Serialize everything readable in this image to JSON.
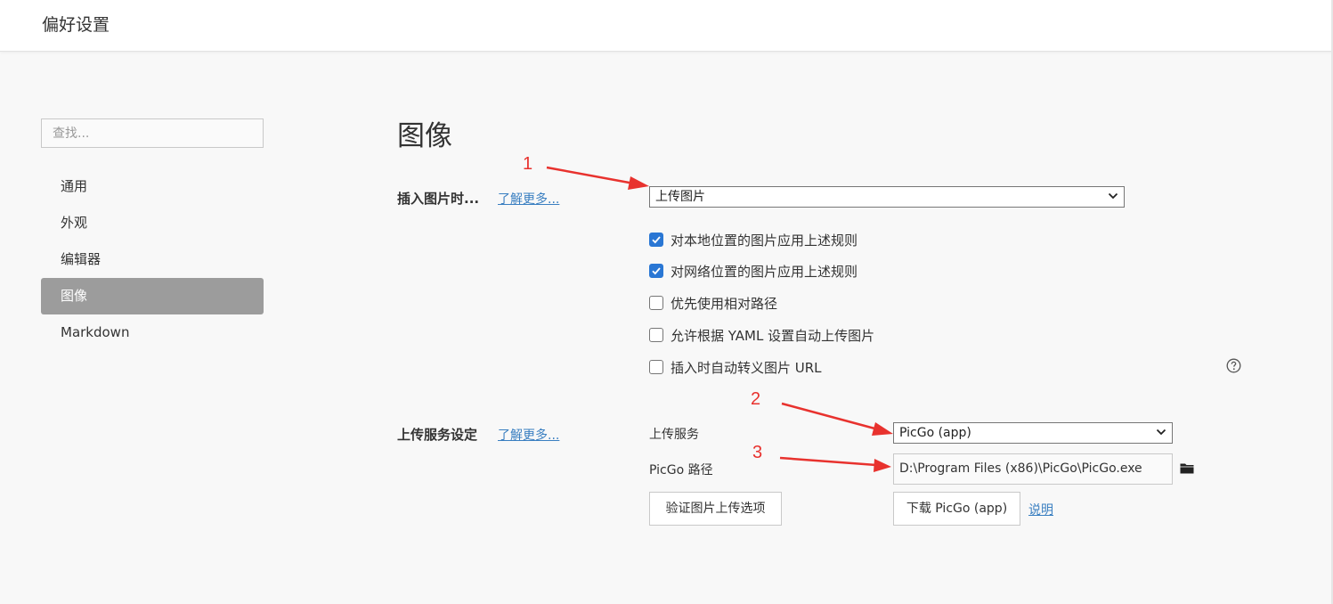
{
  "window": {
    "title": "偏好设置"
  },
  "sidebar": {
    "search_placeholder": "查找...",
    "items": [
      {
        "label": "通用",
        "active": false
      },
      {
        "label": "外观",
        "active": false
      },
      {
        "label": "编辑器",
        "active": false
      },
      {
        "label": "图像",
        "active": true
      },
      {
        "label": "Markdown",
        "active": false
      }
    ]
  },
  "main": {
    "title": "图像",
    "insert_section": {
      "label": "插入图片时...",
      "learn_more": "了解更多...",
      "action_select": "上传图片",
      "options": [
        {
          "label": "对本地位置的图片应用上述规则",
          "checked": true
        },
        {
          "label": "对网络位置的图片应用上述规则",
          "checked": true
        },
        {
          "label": "优先使用相对路径",
          "checked": false
        },
        {
          "label": "允许根据 YAML 设置自动上传图片",
          "checked": false
        },
        {
          "label": "插入时自动转义图片 URL",
          "checked": false
        }
      ],
      "help_icon": "question-circle-icon"
    },
    "upload_section": {
      "label": "上传服务设定",
      "learn_more": "了解更多...",
      "service_label": "上传服务",
      "service_select": "PicGo (app)",
      "path_label": "PicGo 路径",
      "path_value": "D:\\Program Files (x86)\\PicGo\\PicGo.exe",
      "folder_icon": "folder-icon",
      "verify_button": "验证图片上传选项",
      "download_button": "下载 PicGo (app)",
      "explain_link": "说明"
    }
  },
  "annotations": {
    "numbers": [
      "1",
      "2",
      "3"
    ],
    "color": "#e8322e"
  },
  "colors": {
    "accent": "#2a77d4",
    "link": "#3a7fc1",
    "nav_active_bg": "#9c9c9c",
    "page_bg": "#f8f8f8"
  }
}
